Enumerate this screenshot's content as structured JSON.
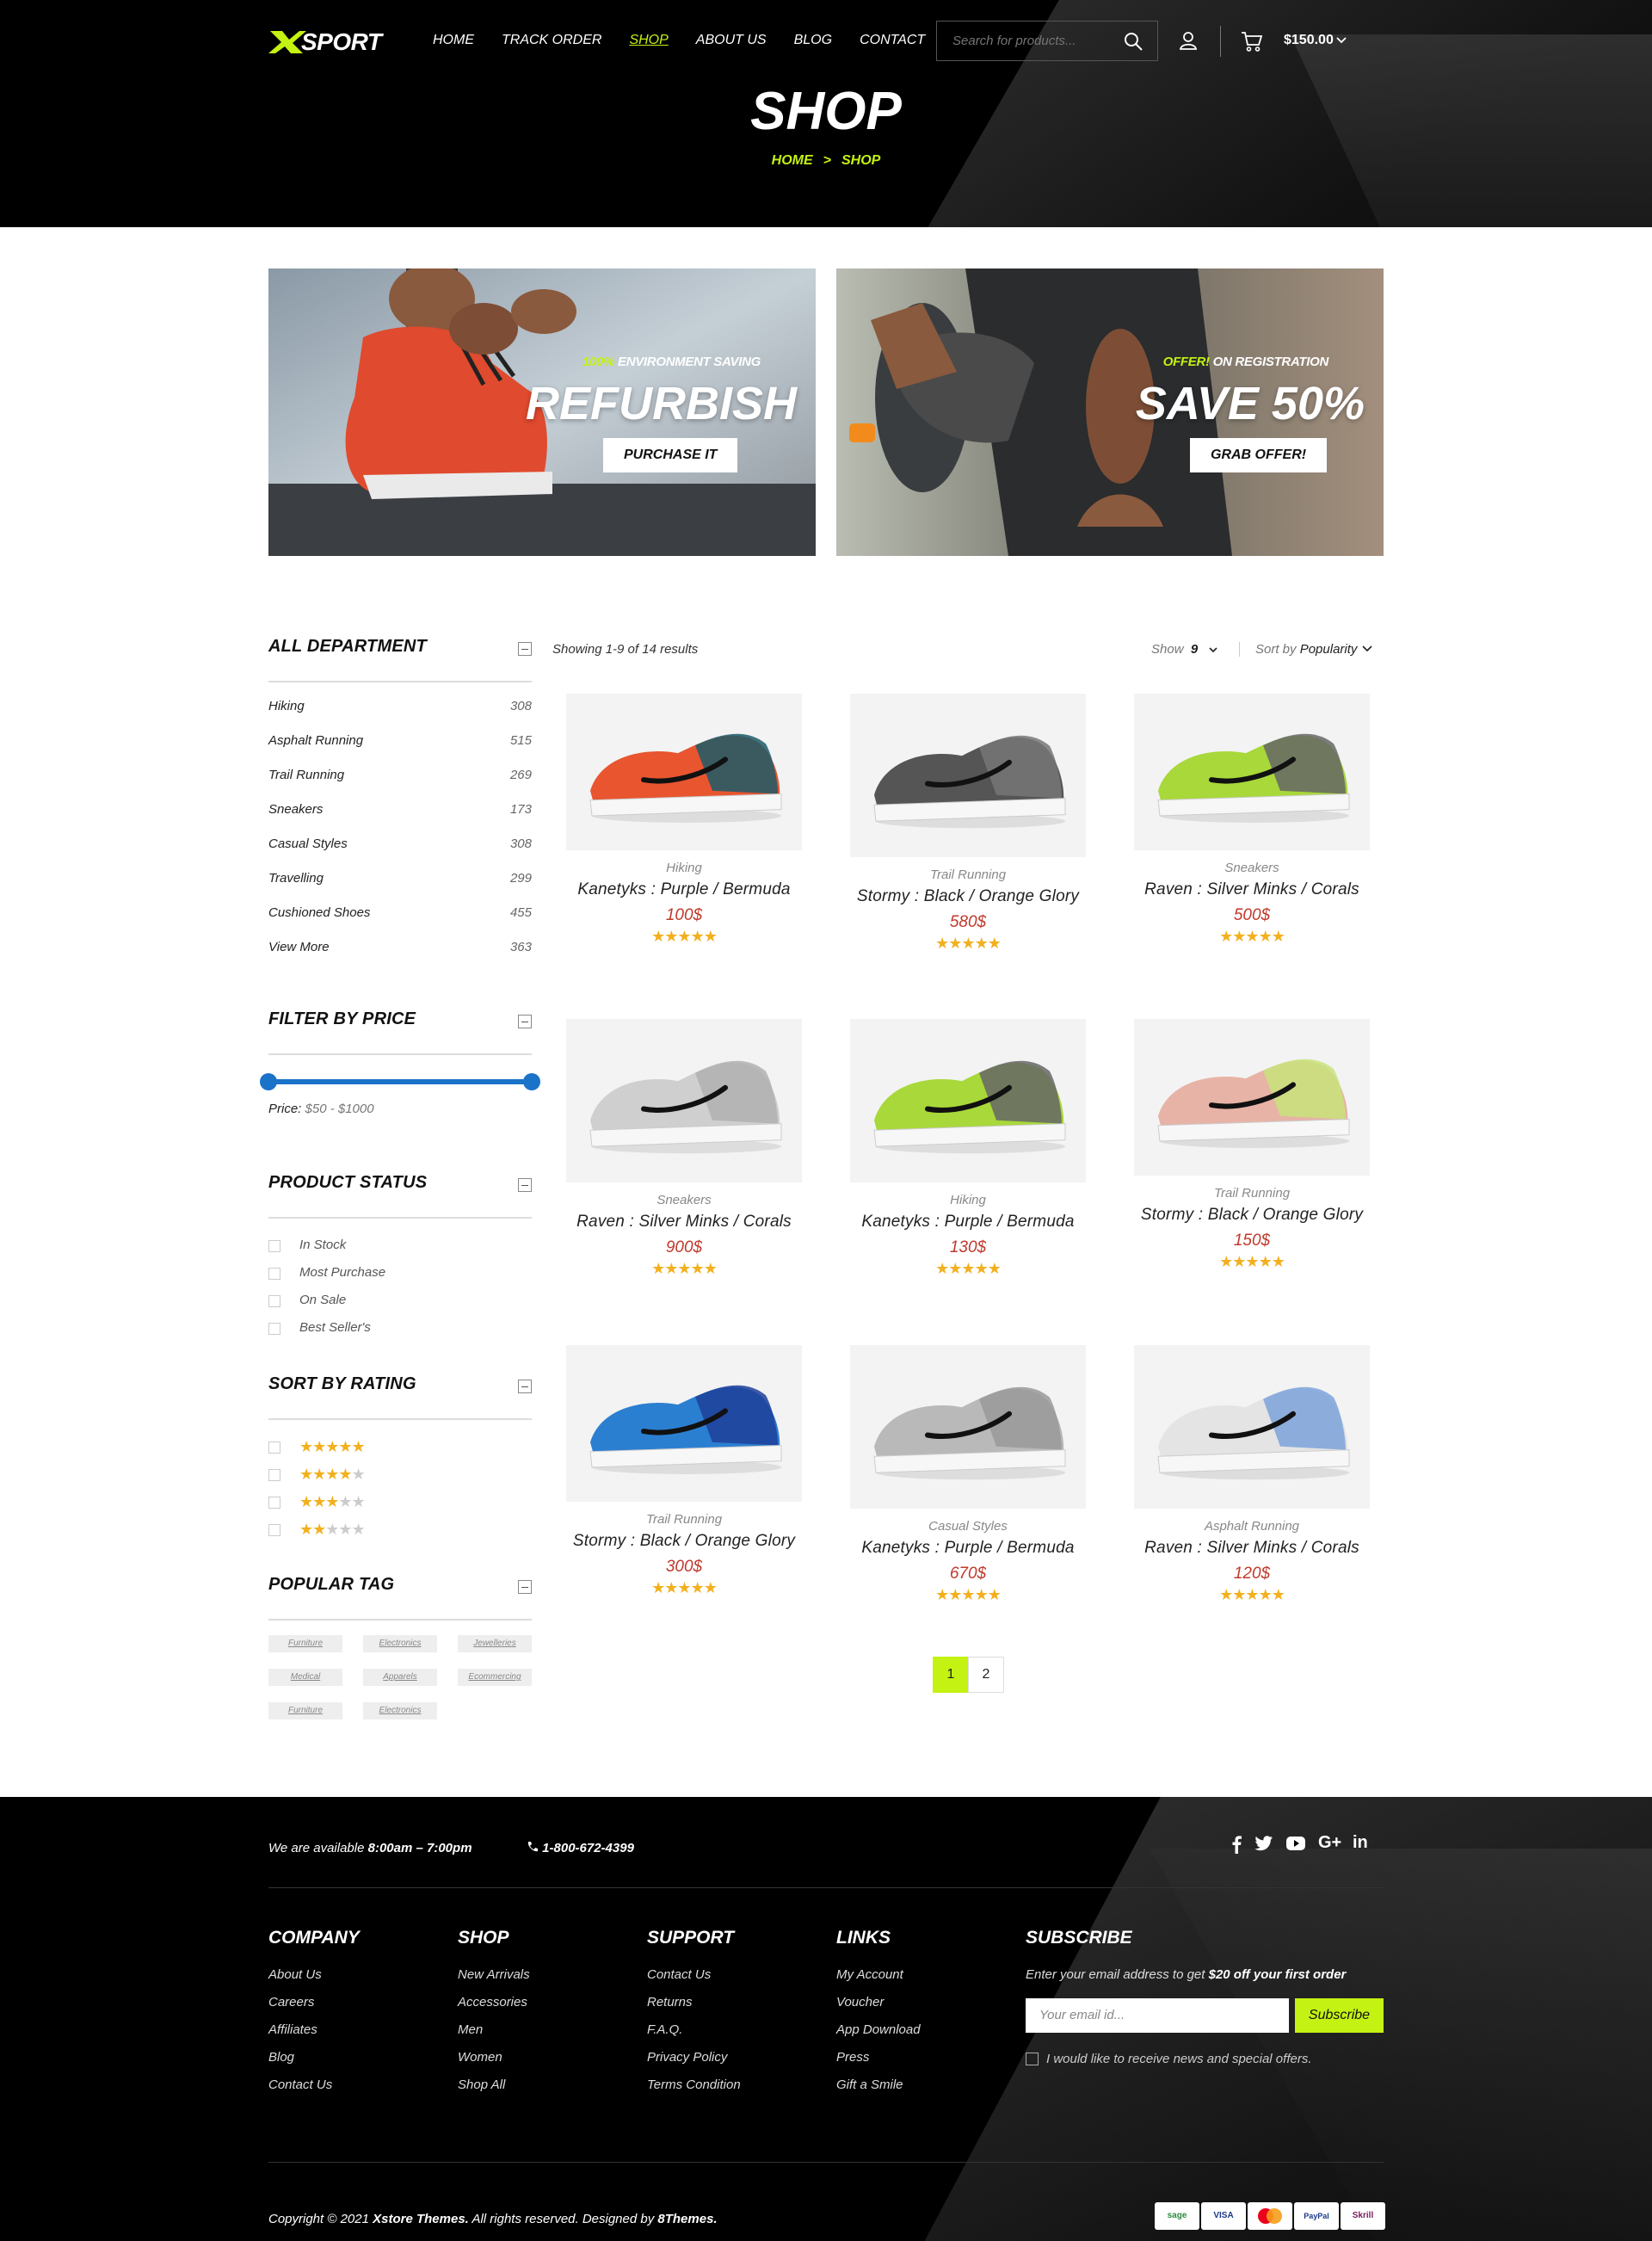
{
  "header": {
    "logo_text": "SPORT",
    "nav": [
      "HOME",
      "TRACK ORDER",
      "SHOP",
      "ABOUT US",
      "BLOG",
      "CONTACT"
    ],
    "active_nav": "SHOP",
    "search_placeholder": "Search for products...",
    "cart_total": "$150.00",
    "page_title": "SHOP",
    "breadcrumb": [
      "HOME",
      ">",
      "SHOP"
    ]
  },
  "banners": [
    {
      "pre_highlight": "100%",
      "pre_text": " ENVIRONMENT SAVING",
      "title": "REFURBISH",
      "button": "PURCHASE IT"
    },
    {
      "pre_highlight": "OFFER!",
      "pre_text": " ON REGISTRATION",
      "title": "SAVE 50%",
      "button": "GRAB OFFER!"
    }
  ],
  "sidebar": {
    "department": {
      "title": "ALL DEPARTMENT",
      "items": [
        {
          "label": "Hiking",
          "count": "308"
        },
        {
          "label": "Asphalt Running",
          "count": "515"
        },
        {
          "label": "Trail Running",
          "count": "269"
        },
        {
          "label": "Sneakers",
          "count": "173"
        },
        {
          "label": "Casual Styles",
          "count": "308"
        },
        {
          "label": "Travelling",
          "count": "299"
        },
        {
          "label": "Cushioned Shoes",
          "count": "455"
        },
        {
          "label": "View More",
          "count": "363"
        }
      ]
    },
    "price": {
      "title": "FILTER BY PRICE",
      "label": "Price:",
      "range": "$50 - $1000"
    },
    "status": {
      "title": "PRODUCT STATUS",
      "items": [
        "In Stock",
        "Most Purchase",
        "On Sale",
        "Best Seller's"
      ]
    },
    "rating": {
      "title": "SORT BY RATING",
      "levels": [
        5,
        4,
        3,
        2
      ]
    },
    "tags": {
      "title": "POPULAR TAG",
      "items": [
        "Furniture",
        "Electronics",
        "Jewelleries",
        "Medical",
        "Apparels",
        "Ecommercing",
        "Furniture",
        "Electronics"
      ]
    }
  },
  "toolbar": {
    "results": "Showing 1-9 of 14 results",
    "show_label": "Show",
    "show_value": "9",
    "sort_label": "Sort by",
    "sort_value": "Popularity"
  },
  "products": [
    {
      "category": "Hiking",
      "name": "Kanetyks : Purple / Bermuda",
      "price": "100$",
      "rating": 5,
      "colors": [
        "#e8552f",
        "#1b5c68"
      ]
    },
    {
      "category": "Trail Running",
      "name": "Stormy : Black / Orange Glory",
      "price": "580$",
      "rating": 5,
      "colors": [
        "#555555",
        "#777777"
      ]
    },
    {
      "category": "Sneakers",
      "name": "Raven : Silver Minks / Corals",
      "price": "500$",
      "rating": 5,
      "colors": [
        "#a8d83a",
        "#666666"
      ]
    },
    {
      "category": "Sneakers",
      "name": "Raven : Silver Minks / Corals",
      "price": "900$",
      "rating": 5,
      "colors": [
        "#cfcfcf",
        "#b0b0b0"
      ]
    },
    {
      "category": "Hiking",
      "name": "Kanetyks : Purple / Bermuda",
      "price": "130$",
      "rating": 5,
      "colors": [
        "#a8d83a",
        "#666666"
      ]
    },
    {
      "category": "Trail Running",
      "name": "Stormy : Black / Orange Glory",
      "price": "150$",
      "rating": 5,
      "colors": [
        "#e7b3a6",
        "#c8e27a"
      ]
    },
    {
      "category": "Trail Running",
      "name": "Stormy : Black / Orange Glory",
      "price": "300$",
      "rating": 5,
      "colors": [
        "#2b7fd1",
        "#1f3f9a"
      ]
    },
    {
      "category": "Casual Styles",
      "name": "Kanetyks : Purple / Bermuda",
      "price": "670$",
      "rating": 5,
      "colors": [
        "#b9b9b9",
        "#999999"
      ]
    },
    {
      "category": "Asphalt Running",
      "name": "Raven : Silver Minks / Corals",
      "price": "120$",
      "rating": 5,
      "colors": [
        "#e4e4e4",
        "#7da3d9"
      ]
    }
  ],
  "pagination": [
    "1",
    "2"
  ],
  "footer": {
    "avail_prefix": "We are available ",
    "avail_hours": "8:00am – 7:00pm",
    "phone": "1-800-672-4399",
    "social": [
      "f",
      "t",
      "yt",
      "G+",
      "in"
    ],
    "columns": [
      {
        "title": "COMPANY",
        "links": [
          "About Us",
          "Careers",
          "Affiliates",
          "Blog",
          "Contact Us"
        ]
      },
      {
        "title": "SHOP",
        "links": [
          "New Arrivals",
          "Accessories",
          "Men",
          "Women",
          "Shop All"
        ]
      },
      {
        "title": "SUPPORT",
        "links": [
          "Contact Us",
          "Returns",
          "F.A.Q.",
          "Privacy Policy",
          "Terms Condition"
        ]
      },
      {
        "title": "LINKS",
        "links": [
          "My Account",
          "Voucher",
          "App Download",
          "Press",
          "Gift a Smile"
        ]
      }
    ],
    "subscribe": {
      "title": "SUBSCRIBE",
      "text_prefix": "Enter your email address to get ",
      "text_bold": "$20 off your first order",
      "placeholder": "Your email id...",
      "button": "Subscribe",
      "checkbox_label": "I would like to receive news and special offers."
    },
    "copyright_prefix": "Copyright © 2021 ",
    "copyright_brand": "Xstore Themes.",
    "copyright_mid": " All rights reserved. Designed by ",
    "copyright_designer": "8Themes.",
    "payments": [
      "sage",
      "VISA",
      "MasterCard",
      "PayPal",
      "Skrill"
    ]
  },
  "colors": {
    "accent": "#c4f212",
    "price": "#c0392b",
    "star": "#f2b01e",
    "slider": "#1b73c9"
  }
}
